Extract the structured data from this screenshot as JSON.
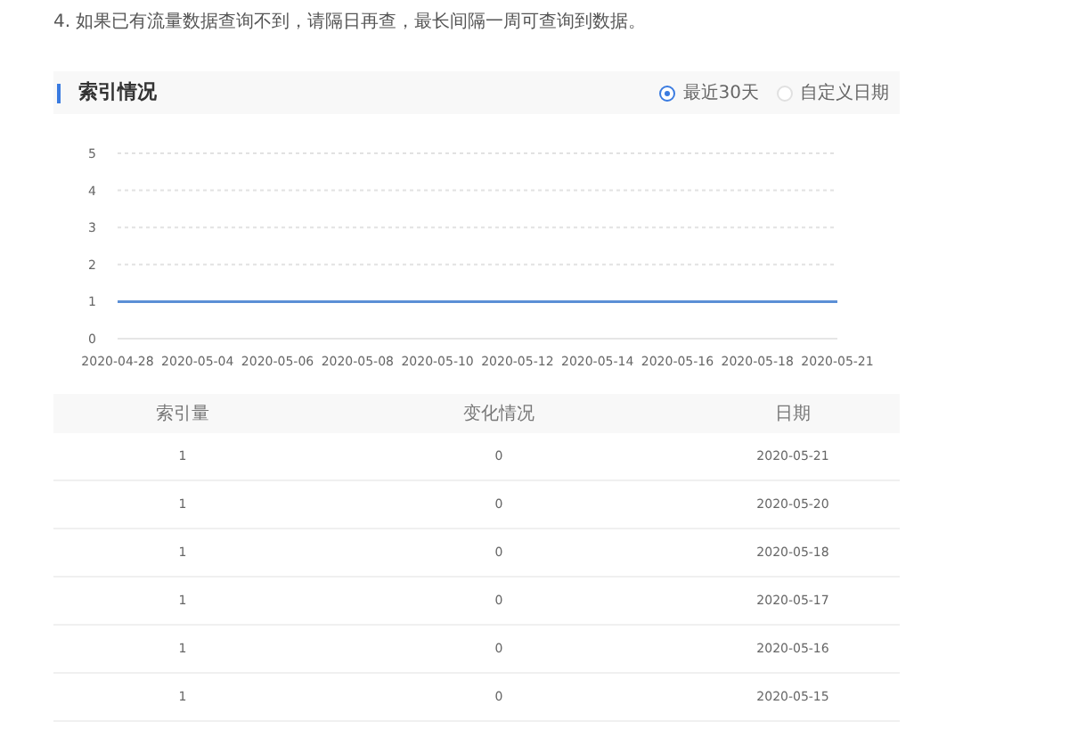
{
  "notes": [
    "4. 如果已有流量数据查询不到，请隔日再查，最长间隔一周可查询到数据。"
  ],
  "section": {
    "title": "索引情况",
    "range_options": [
      {
        "label": "最近30天",
        "selected": true
      },
      {
        "label": "自定义日期",
        "selected": false
      }
    ]
  },
  "chart_data": {
    "type": "line",
    "categories": [
      "2020-04-28",
      "2020-05-04",
      "2020-05-06",
      "2020-05-08",
      "2020-05-10",
      "2020-05-12",
      "2020-05-14",
      "2020-05-16",
      "2020-05-18",
      "2020-05-21"
    ],
    "series": [
      {
        "color": "#5b8fd6",
        "values": [
          1,
          1,
          1,
          1,
          1,
          1,
          1,
          1,
          1,
          1
        ]
      }
    ],
    "grid": true,
    "ylim": [
      0,
      5
    ],
    "yticks": [
      0,
      1,
      2,
      3,
      4,
      5
    ]
  },
  "table": {
    "columns": [
      "索引量",
      "变化情况",
      "日期"
    ],
    "rows": [
      [
        "1",
        "0",
        "2020-05-21"
      ],
      [
        "1",
        "0",
        "2020-05-20"
      ],
      [
        "1",
        "0",
        "2020-05-18"
      ],
      [
        "1",
        "0",
        "2020-05-17"
      ],
      [
        "1",
        "0",
        "2020-05-16"
      ],
      [
        "1",
        "0",
        "2020-05-15"
      ]
    ]
  }
}
